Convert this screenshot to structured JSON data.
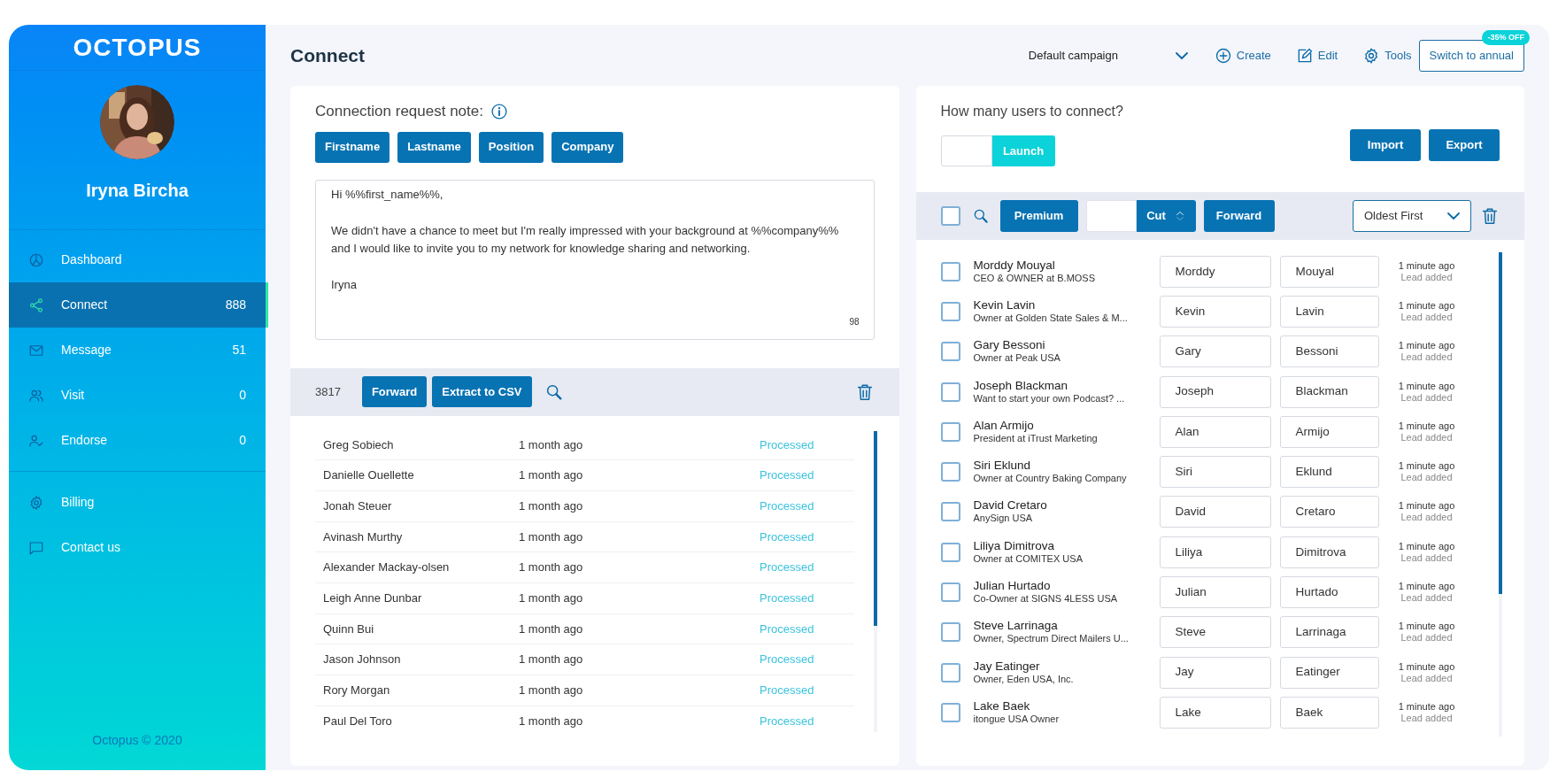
{
  "sidebar": {
    "logo": "OCTOPUS",
    "user_name": "Iryna Bircha",
    "nav": [
      {
        "label": "Dashboard",
        "selected": false
      },
      {
        "label": "Connect",
        "count": "888",
        "selected": true
      },
      {
        "label": "Message",
        "count": "51",
        "selected": false
      },
      {
        "label": "Visit",
        "count": "0",
        "selected": false
      },
      {
        "label": "Endorse",
        "count": "0",
        "selected": false
      }
    ],
    "secondary_nav": [
      {
        "label": "Billing",
        "selected": false
      },
      {
        "label": "Contact us",
        "selected": false
      }
    ],
    "footer": "Octopus © 2020"
  },
  "header": {
    "title": "Connect",
    "campaign_select": "Default campaign",
    "actions": [
      "Create",
      "Edit",
      "Tools"
    ],
    "plan_button": "Switch to annual",
    "plan_badge": "-35% OFF"
  },
  "note_panel": {
    "label": "Connection request note:",
    "tokens": [
      "Firstname",
      "Lastname",
      "Position",
      "Company"
    ],
    "message": "Hi %%first_name%%,\n\nWe didn't have a chance to meet but I'm really impressed with your background at %%company%% and I would like to invite you to my network for knowledge sharing and networking.\n\nIryna",
    "char_count": "98",
    "toolbar": {
      "count": "3817",
      "buttons": [
        "Forward",
        "Extract to CSV"
      ]
    },
    "rows": [
      {
        "name": "Greg Sobiech",
        "time": "1 month ago",
        "status": "Processed"
      },
      {
        "name": "Danielle Ouellette",
        "time": "1 month ago",
        "status": "Processed"
      },
      {
        "name": "Jonah Steuer",
        "time": "1 month ago",
        "status": "Processed"
      },
      {
        "name": "Avinash Murthy",
        "time": "1 month ago",
        "status": "Processed"
      },
      {
        "name": "Alexander Mackay-olsen",
        "time": "1 month ago",
        "status": "Processed"
      },
      {
        "name": "Leigh Anne Dunbar",
        "time": "1 month ago",
        "status": "Processed"
      },
      {
        "name": "Quinn Bui",
        "time": "1 month ago",
        "status": "Processed"
      },
      {
        "name": "Jason Johnson",
        "time": "1 month ago",
        "status": "Processed"
      },
      {
        "name": "Rory Morgan",
        "time": "1 month ago",
        "status": "Processed"
      },
      {
        "name": "Paul Del Toro",
        "time": "1 month ago",
        "status": "Processed"
      }
    ]
  },
  "leads_panel": {
    "question": "How many users to connect?",
    "launch_button": "Launch",
    "import_button": "Import",
    "export_button": "Export",
    "toolbar": {
      "select_all_checked": false,
      "premium_button": "Premium",
      "cut_button": "Cut",
      "forward_button": "Forward",
      "sort_select": "Oldest First"
    },
    "leads": [
      {
        "name": "Morddy Mouyal",
        "headline": "CEO & OWNER at B.MOSS",
        "first_name": "Morddy",
        "last_name": "Mouyal",
        "time": "1 minute ago",
        "note": "Lead added",
        "checked": false
      },
      {
        "name": "Kevin Lavin",
        "headline": "Owner at Golden State Sales & M...",
        "first_name": "Kevin",
        "last_name": "Lavin",
        "time": "1 minute ago",
        "note": "Lead added",
        "checked": false
      },
      {
        "name": "Gary Bessoni",
        "headline": "Owner at Peak USA",
        "first_name": "Gary",
        "last_name": "Bessoni",
        "time": "1 minute ago",
        "note": "Lead added",
        "checked": false
      },
      {
        "name": "Joseph Blackman",
        "headline": "Want to start your own Podcast? ...",
        "first_name": "Joseph",
        "last_name": "Blackman",
        "time": "1 minute ago",
        "note": "Lead added",
        "checked": false
      },
      {
        "name": "Alan Armijo",
        "headline": "President at iTrust Marketing",
        "first_name": "Alan",
        "last_name": "Armijo",
        "time": "1 minute ago",
        "note": "Lead added",
        "checked": false
      },
      {
        "name": "Siri Eklund",
        "headline": "Owner at Country Baking Company",
        "first_name": "Siri",
        "last_name": "Eklund",
        "time": "1 minute ago",
        "note": "Lead added",
        "checked": false
      },
      {
        "name": "David Cretaro",
        "headline": "AnySign USA",
        "first_name": "David",
        "last_name": "Cretaro",
        "time": "1 minute ago",
        "note": "Lead added",
        "checked": false
      },
      {
        "name": "Liliya Dimitrova",
        "headline": "Owner at COMITEX USA",
        "first_name": "Liliya",
        "last_name": "Dimitrova",
        "time": "1 minute ago",
        "note": "Lead added",
        "checked": false
      },
      {
        "name": "Julian Hurtado",
        "headline": "Co-Owner at SIGNS 4LESS USA",
        "first_name": "Julian",
        "last_name": "Hurtado",
        "time": "1 minute ago",
        "note": "Lead added",
        "checked": false
      },
      {
        "name": "Steve Larrinaga",
        "headline": "Owner, Spectrum Direct Mailers U...",
        "first_name": "Steve",
        "last_name": "Larrinaga",
        "time": "1 minute ago",
        "note": "Lead added",
        "checked": false
      },
      {
        "name": "Jay Eatinger",
        "headline": "Owner, Eden USA, Inc.",
        "first_name": "Jay",
        "last_name": "Eatinger",
        "time": "1 minute ago",
        "note": "Lead added",
        "checked": false
      },
      {
        "name": "Lake Baek",
        "headline": "itongue USA Owner",
        "first_name": "Lake",
        "last_name": "Baek",
        "time": "1 minute ago",
        "note": "Lead added",
        "checked": false
      }
    ]
  }
}
